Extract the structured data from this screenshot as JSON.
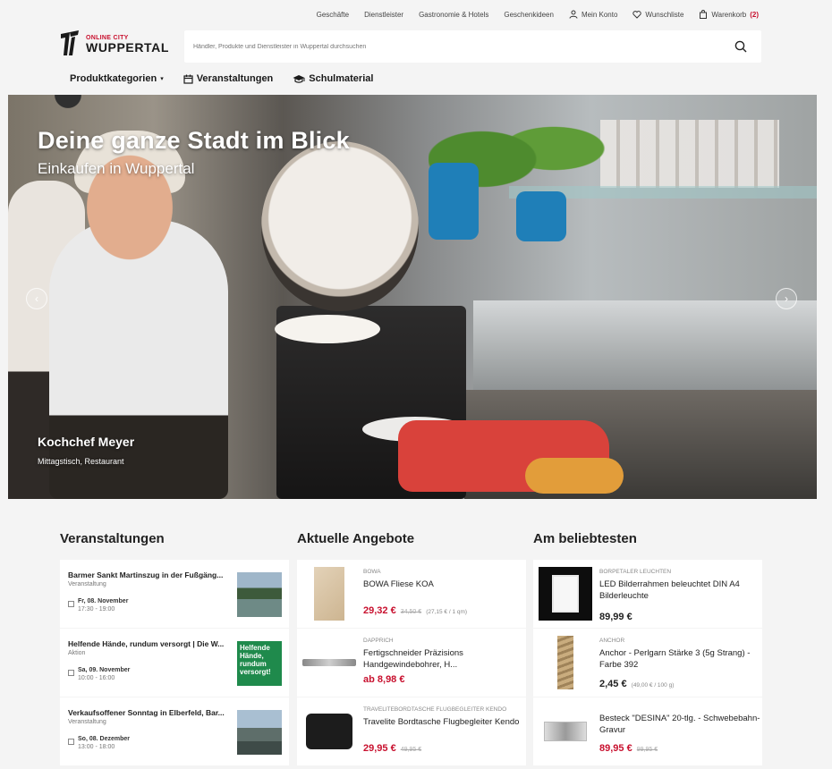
{
  "toplinks": {
    "shops": "Geschäfte",
    "services": "Dienstleister",
    "gastro": "Gastronomie & Hotels",
    "gifts": "Geschenkideen",
    "account": "Mein Konto",
    "wishlist": "Wunschliste",
    "cart": "Warenkorb",
    "cart_count": "(2)"
  },
  "logo": {
    "line1": "ONLINE CITY",
    "line2": "WUPPERTAL"
  },
  "search": {
    "placeholder": "Händler, Produkte und Dienstleister in Wuppertal durchsuchen"
  },
  "nav": {
    "categories": "Produktkategorien",
    "events": "Veranstaltungen",
    "school": "Schulmaterial"
  },
  "hero": {
    "title": "Deine ganze Stadt im Blick",
    "subtitle": "Einkaufen in Wuppertal",
    "name": "Kochchef Meyer",
    "desc": "Mittagstisch, Restaurant"
  },
  "sections": {
    "events": "Veranstaltungen",
    "offers": "Aktuelle Angebote",
    "popular": "Am beliebtesten"
  },
  "events": [
    {
      "title": "Barmer Sankt Martinszug in der Fußgäng...",
      "type": "Veranstaltung",
      "date": "Fr, 08. November",
      "time": "17:30 - 19:00"
    },
    {
      "title": "Helfende Hände, rundum versorgt | Die W...",
      "type": "Aktion",
      "date": "Sa, 09. November",
      "time": "10:00 - 16:00",
      "thumb_text": "Helfende Hände, rundum versorgt!"
    },
    {
      "title": "Verkaufsoffener Sonntag in Elberfeld, Bar...",
      "type": "Veranstaltung",
      "date": "So, 08. Dezember",
      "time": "13:00 - 18:00"
    }
  ],
  "offers": [
    {
      "brand": "BOWA",
      "name": "BOWA Fliese KOA",
      "price": "29,32 €",
      "old": "34,50 €",
      "unit": "(27,15 € / 1 qm)"
    },
    {
      "brand": "DAPPRICH",
      "name": "Fertigschneider Präzisions Handgewindebohrer, H...",
      "price": "ab 8,98 €"
    },
    {
      "brand": "TRAVELITEBORDTASCHE FLUGBEGLEITER KENDO",
      "name": "Travelite Bordtasche Flugbegleiter Kendo",
      "price": "29,95 €",
      "old": "49,95 €"
    }
  ],
  "popular": [
    {
      "brand": "BORPETALER LEUCHTEN",
      "name": "LED Bilderrahmen beleuchtet DIN A4 Bilderleuchte",
      "price": "89,99 €"
    },
    {
      "brand": "ANCHOR",
      "name": "Anchor - Perlgarn Stärke 3 (5g Strang) - Farbe 392",
      "price": "2,45 €",
      "unit": "(49,00 € / 100 g)"
    },
    {
      "brand": "",
      "name": "Besteck \"DESINA\" 20-tlg. - Schwebebahn-Gravur",
      "price": "89,95 €",
      "old": "99,95 €"
    }
  ],
  "colors": {
    "accent": "#c8102e",
    "background": "#f4f4f4"
  }
}
